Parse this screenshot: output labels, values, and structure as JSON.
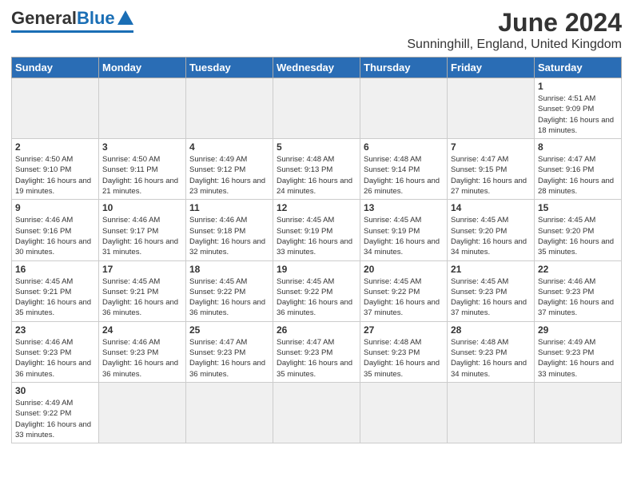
{
  "logo": {
    "general": "General",
    "blue": "Blue"
  },
  "title": {
    "month_year": "June 2024",
    "location": "Sunninghill, England, United Kingdom"
  },
  "weekdays": [
    "Sunday",
    "Monday",
    "Tuesday",
    "Wednesday",
    "Thursday",
    "Friday",
    "Saturday"
  ],
  "days": [
    {
      "num": "",
      "info": "",
      "empty": true
    },
    {
      "num": "",
      "info": "",
      "empty": true
    },
    {
      "num": "",
      "info": "",
      "empty": true
    },
    {
      "num": "",
      "info": "",
      "empty": true
    },
    {
      "num": "",
      "info": "",
      "empty": true
    },
    {
      "num": "",
      "info": "",
      "empty": true
    },
    {
      "num": "1",
      "info": "Sunrise: 4:51 AM\nSunset: 9:09 PM\nDaylight: 16 hours\nand 18 minutes."
    },
    {
      "num": "2",
      "info": "Sunrise: 4:50 AM\nSunset: 9:10 PM\nDaylight: 16 hours\nand 19 minutes."
    },
    {
      "num": "3",
      "info": "Sunrise: 4:50 AM\nSunset: 9:11 PM\nDaylight: 16 hours\nand 21 minutes."
    },
    {
      "num": "4",
      "info": "Sunrise: 4:49 AM\nSunset: 9:12 PM\nDaylight: 16 hours\nand 23 minutes."
    },
    {
      "num": "5",
      "info": "Sunrise: 4:48 AM\nSunset: 9:13 PM\nDaylight: 16 hours\nand 24 minutes."
    },
    {
      "num": "6",
      "info": "Sunrise: 4:48 AM\nSunset: 9:14 PM\nDaylight: 16 hours\nand 26 minutes."
    },
    {
      "num": "7",
      "info": "Sunrise: 4:47 AM\nSunset: 9:15 PM\nDaylight: 16 hours\nand 27 minutes."
    },
    {
      "num": "8",
      "info": "Sunrise: 4:47 AM\nSunset: 9:16 PM\nDaylight: 16 hours\nand 28 minutes."
    },
    {
      "num": "9",
      "info": "Sunrise: 4:46 AM\nSunset: 9:16 PM\nDaylight: 16 hours\nand 30 minutes."
    },
    {
      "num": "10",
      "info": "Sunrise: 4:46 AM\nSunset: 9:17 PM\nDaylight: 16 hours\nand 31 minutes."
    },
    {
      "num": "11",
      "info": "Sunrise: 4:46 AM\nSunset: 9:18 PM\nDaylight: 16 hours\nand 32 minutes."
    },
    {
      "num": "12",
      "info": "Sunrise: 4:45 AM\nSunset: 9:19 PM\nDaylight: 16 hours\nand 33 minutes."
    },
    {
      "num": "13",
      "info": "Sunrise: 4:45 AM\nSunset: 9:19 PM\nDaylight: 16 hours\nand 34 minutes."
    },
    {
      "num": "14",
      "info": "Sunrise: 4:45 AM\nSunset: 9:20 PM\nDaylight: 16 hours\nand 34 minutes."
    },
    {
      "num": "15",
      "info": "Sunrise: 4:45 AM\nSunset: 9:20 PM\nDaylight: 16 hours\nand 35 minutes."
    },
    {
      "num": "16",
      "info": "Sunrise: 4:45 AM\nSunset: 9:21 PM\nDaylight: 16 hours\nand 35 minutes."
    },
    {
      "num": "17",
      "info": "Sunrise: 4:45 AM\nSunset: 9:21 PM\nDaylight: 16 hours\nand 36 minutes."
    },
    {
      "num": "18",
      "info": "Sunrise: 4:45 AM\nSunset: 9:22 PM\nDaylight: 16 hours\nand 36 minutes."
    },
    {
      "num": "19",
      "info": "Sunrise: 4:45 AM\nSunset: 9:22 PM\nDaylight: 16 hours\nand 36 minutes."
    },
    {
      "num": "20",
      "info": "Sunrise: 4:45 AM\nSunset: 9:22 PM\nDaylight: 16 hours\nand 37 minutes."
    },
    {
      "num": "21",
      "info": "Sunrise: 4:45 AM\nSunset: 9:23 PM\nDaylight: 16 hours\nand 37 minutes."
    },
    {
      "num": "22",
      "info": "Sunrise: 4:46 AM\nSunset: 9:23 PM\nDaylight: 16 hours\nand 37 minutes."
    },
    {
      "num": "23",
      "info": "Sunrise: 4:46 AM\nSunset: 9:23 PM\nDaylight: 16 hours\nand 36 minutes."
    },
    {
      "num": "24",
      "info": "Sunrise: 4:46 AM\nSunset: 9:23 PM\nDaylight: 16 hours\nand 36 minutes."
    },
    {
      "num": "25",
      "info": "Sunrise: 4:47 AM\nSunset: 9:23 PM\nDaylight: 16 hours\nand 36 minutes."
    },
    {
      "num": "26",
      "info": "Sunrise: 4:47 AM\nSunset: 9:23 PM\nDaylight: 16 hours\nand 35 minutes."
    },
    {
      "num": "27",
      "info": "Sunrise: 4:48 AM\nSunset: 9:23 PM\nDaylight: 16 hours\nand 35 minutes."
    },
    {
      "num": "28",
      "info": "Sunrise: 4:48 AM\nSunset: 9:23 PM\nDaylight: 16 hours\nand 34 minutes."
    },
    {
      "num": "29",
      "info": "Sunrise: 4:49 AM\nSunset: 9:23 PM\nDaylight: 16 hours\nand 33 minutes."
    },
    {
      "num": "30",
      "info": "Sunrise: 4:49 AM\nSunset: 9:22 PM\nDaylight: 16 hours\nand 33 minutes."
    },
    {
      "num": "",
      "info": "",
      "empty": true
    },
    {
      "num": "",
      "info": "",
      "empty": true
    },
    {
      "num": "",
      "info": "",
      "empty": true
    },
    {
      "num": "",
      "info": "",
      "empty": true
    },
    {
      "num": "",
      "info": "",
      "empty": true
    },
    {
      "num": "",
      "info": "",
      "empty": true
    }
  ]
}
